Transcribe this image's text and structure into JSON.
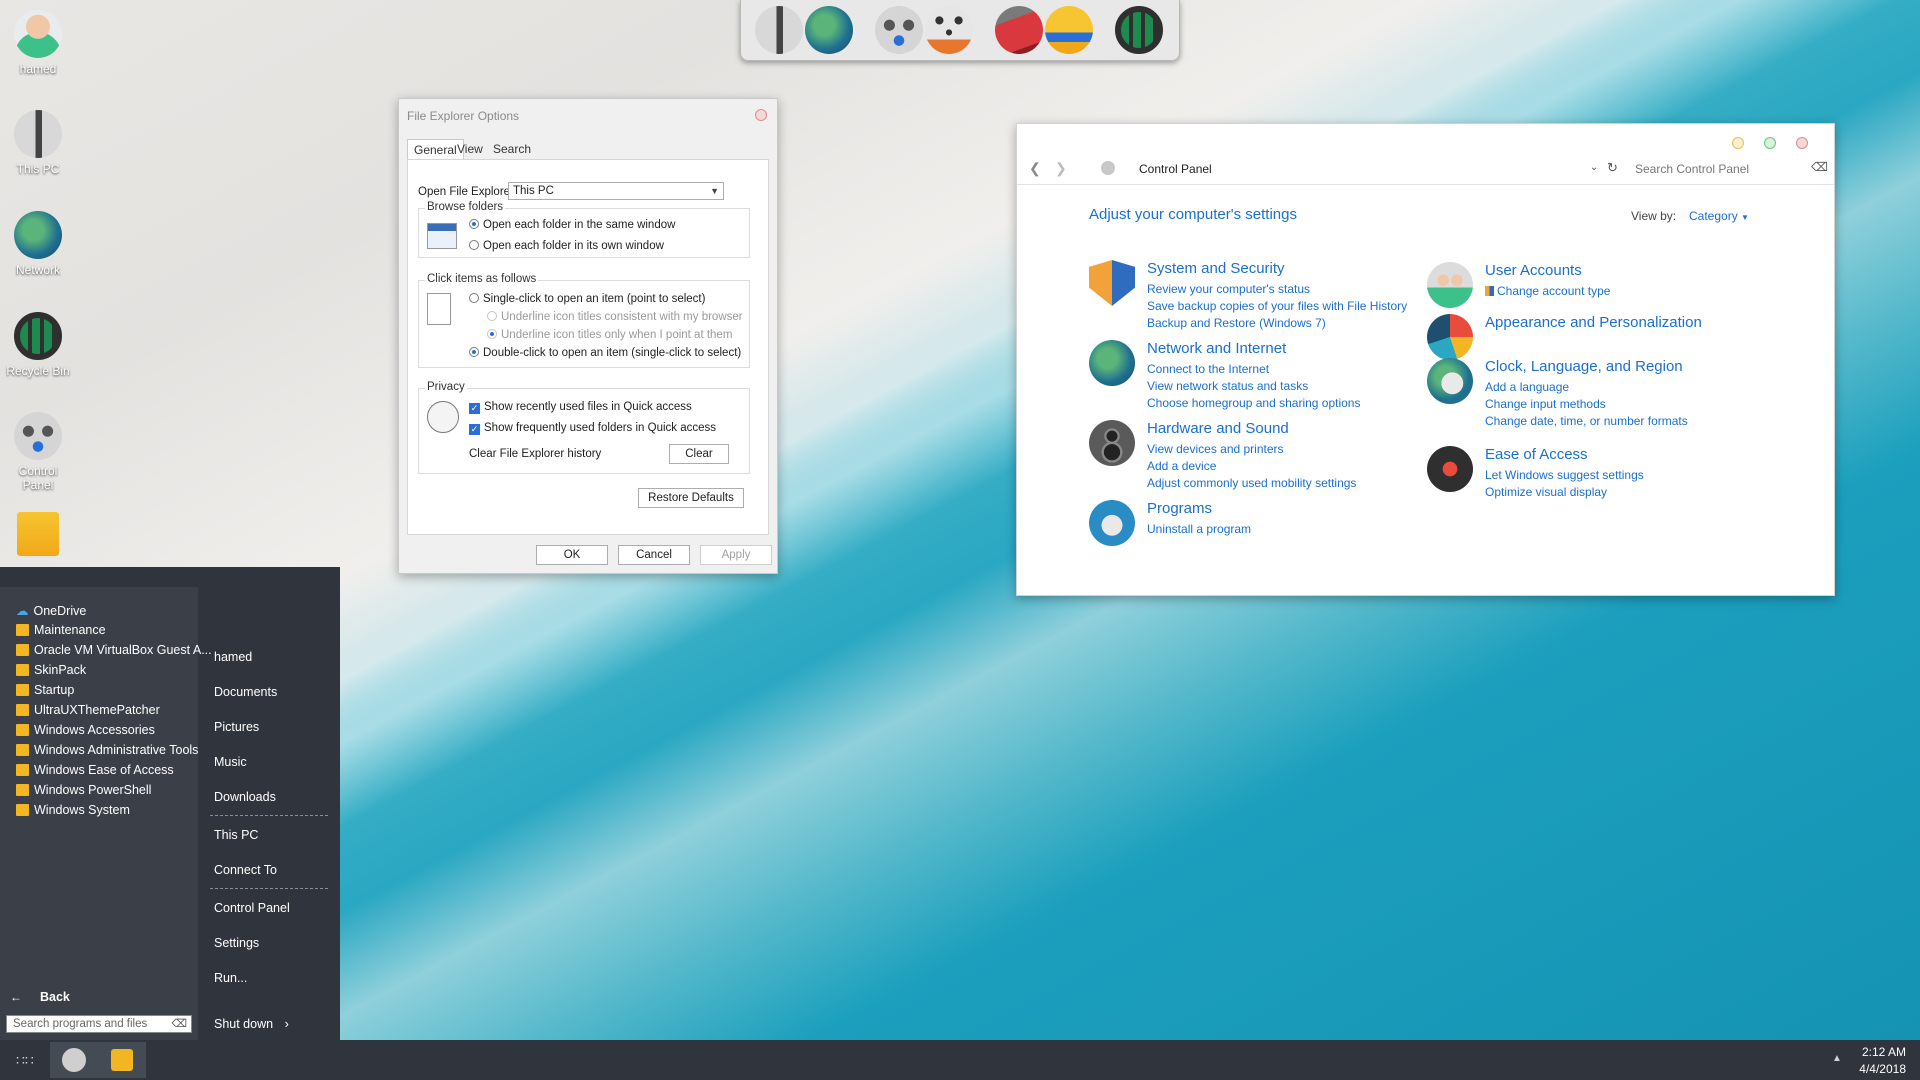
{
  "desktop": {
    "icons": [
      {
        "label": "hamed",
        "icon": "user-icon"
      },
      {
        "label": "This PC",
        "icon": "computer-icon"
      },
      {
        "label": "Network",
        "icon": "globe-icon"
      },
      {
        "label": "Recycle Bin",
        "icon": "recycle-bin-icon"
      },
      {
        "label": "Control Panel",
        "icon": "control-panel-icon"
      },
      {
        "label": "",
        "icon": "folder-icon"
      }
    ]
  },
  "dock": {
    "items": [
      "computer-icon",
      "globe-icon",
      "control-panel-icon",
      "dice-icon",
      "toolbox-icon",
      "folder-icon",
      "recycle-bin-icon"
    ]
  },
  "file_explorer_options": {
    "title": "File Explorer Options",
    "tabs": [
      "General",
      "View",
      "Search"
    ],
    "open_label": "Open File Explorer to:",
    "open_value": "This PC",
    "browse_folders": {
      "label": "Browse folders",
      "options": [
        "Open each folder in the same window",
        "Open each folder in its own window"
      ]
    },
    "click_items": {
      "label": "Click items as follows",
      "single": "Single-click to open an item (point to select)",
      "underline_browser": "Underline icon titles consistent with my browser",
      "underline_point": "Underline icon titles only when I point at them",
      "double": "Double-click to open an item (single-click to select)"
    },
    "privacy": {
      "label": "Privacy",
      "recent_files": "Show recently used files in Quick access",
      "frequent_folders": "Show frequently used folders in Quick access",
      "clear_history": "Clear File Explorer history",
      "clear_button": "Clear"
    },
    "restore_defaults": "Restore Defaults",
    "ok": "OK",
    "cancel": "Cancel",
    "apply": "Apply"
  },
  "control_panel": {
    "address": "Control Panel",
    "search_placeholder": "Search Control Panel",
    "heading": "Adjust your computer's settings",
    "view_by_label": "View by:",
    "view_by_value": "Category",
    "categories_left": [
      {
        "title": "System and Security",
        "links": [
          "Review your computer's status",
          "Save backup copies of your files with File History",
          "Backup and Restore (Windows 7)"
        ]
      },
      {
        "title": "Network and Internet",
        "links": [
          "Connect to the Internet",
          "View network status and tasks",
          "Choose homegroup and sharing options"
        ]
      },
      {
        "title": "Hardware and Sound",
        "links": [
          "View devices and printers",
          "Add a device",
          "Adjust commonly used mobility settings"
        ]
      },
      {
        "title": "Programs",
        "links": [
          "Uninstall a program"
        ]
      }
    ],
    "categories_right": [
      {
        "title": "User Accounts",
        "links": [
          "Change account type"
        ]
      },
      {
        "title": "Appearance and Personalization",
        "links": []
      },
      {
        "title": "Clock, Language, and Region",
        "links": [
          "Add a language",
          "Change input methods",
          "Change date, time, or number formats"
        ]
      },
      {
        "title": "Ease of Access",
        "links": [
          "Let Windows suggest settings",
          "Optimize visual display"
        ]
      }
    ]
  },
  "start_menu": {
    "programs": [
      "OneDrive",
      "Maintenance",
      "Oracle VM VirtualBox Guest A...",
      "SkinPack",
      "Startup",
      "UltraUXThemePatcher",
      "Windows Accessories",
      "Windows Administrative Tools",
      "Windows Ease of Access",
      "Windows PowerShell",
      "Windows System"
    ],
    "places": [
      "hamed",
      "Documents",
      "Pictures",
      "Music",
      "Downloads",
      "This PC",
      "Connect To",
      "Control Panel",
      "Settings",
      "Run..."
    ],
    "back": "Back",
    "search_placeholder": "Search programs and files",
    "shutdown": "Shut down"
  },
  "taskbar": {
    "time": "2:12 AM",
    "date": "4/4/2018"
  },
  "colors": {
    "accent": "#1a6fcf",
    "startmenu_bg": "#30343c",
    "folder": "#f2b623"
  }
}
